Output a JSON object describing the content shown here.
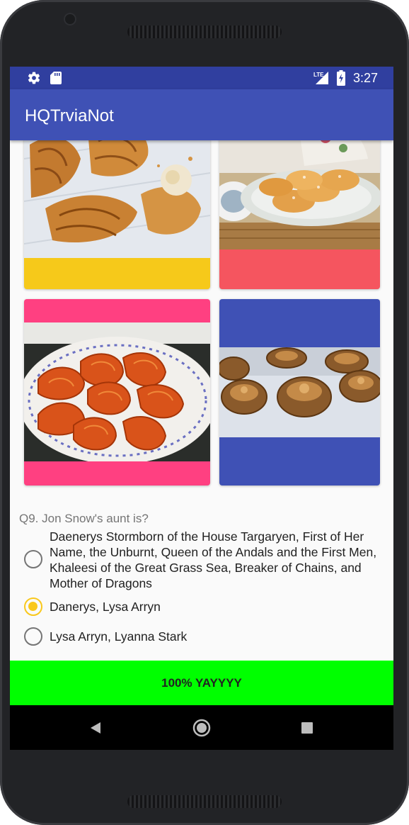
{
  "status_bar": {
    "time": "3:27",
    "left_icons": [
      "gear-icon",
      "sd-card-icon"
    ],
    "right_icons": [
      "lte-signal-icon",
      "battery-charging-icon"
    ],
    "color": "#303f9f"
  },
  "app_bar": {
    "title": "HQTrviaNot",
    "color": "#3f51b5"
  },
  "cards": [
    {
      "name": "croissants",
      "accent": "#f6c91a"
    },
    {
      "name": "madeleines",
      "accent": "#f5555f"
    },
    {
      "name": "palmiers",
      "accent": "#ff4081"
    },
    {
      "name": "kouign-amann",
      "accent": "#3f51b5"
    }
  ],
  "quiz": {
    "question": "Q9. Jon Snow's aunt is?",
    "options": [
      {
        "label": "Daenerys Stormborn of the House Targaryen, First of Her Name, the Unburnt, Queen of the Andals and the First Men, Khaleesi of the Great Grass Sea, Breaker of Chains, and Mother of Dragons",
        "selected": false
      },
      {
        "label": "Danerys, Lysa Arryn",
        "selected": true
      },
      {
        "label": "Lysa Arryn, Lyanna Stark",
        "selected": false
      }
    ],
    "accent": "#f9c81c"
  },
  "result": {
    "text": "100% YAYYYY",
    "color": "#00ff00"
  },
  "nav_bar": {
    "buttons": [
      "back-icon",
      "home-icon",
      "recents-icon"
    ]
  }
}
